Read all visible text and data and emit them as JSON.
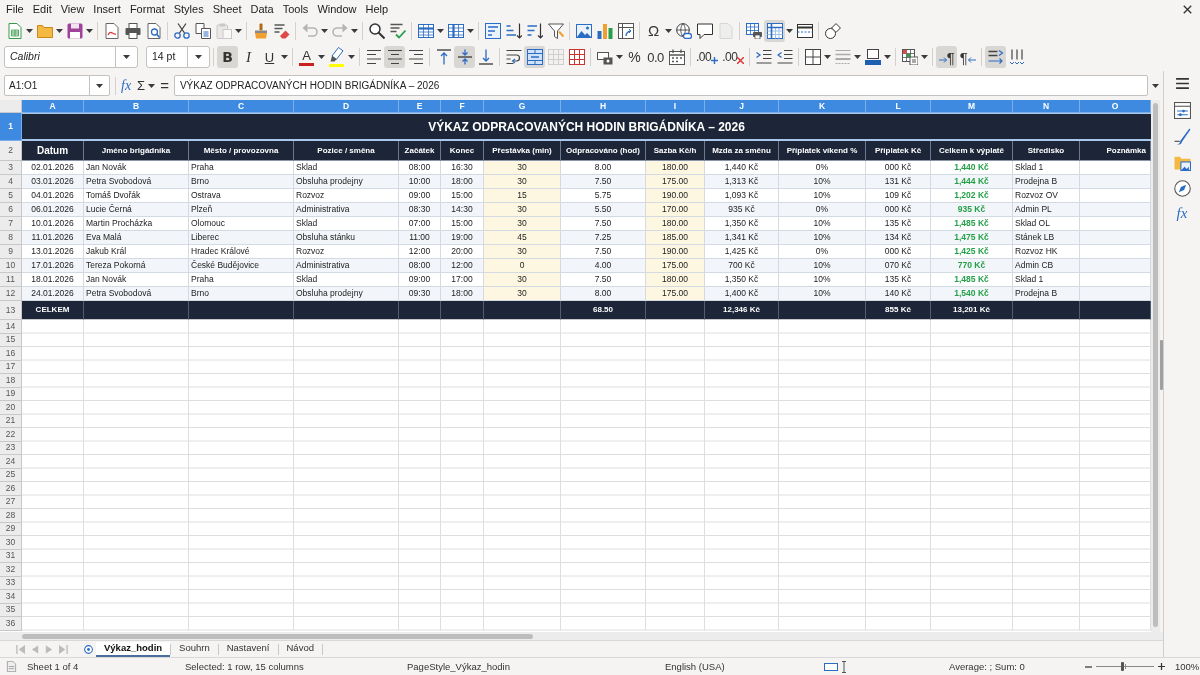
{
  "menu": [
    "File",
    "Edit",
    "View",
    "Insert",
    "Format",
    "Styles",
    "Sheet",
    "Data",
    "Tools",
    "Window",
    "Help"
  ],
  "standard_toolbar": {
    "paste": {
      "disabled": true
    },
    "undo": {
      "disabled": true
    },
    "redo": {
      "disabled": true
    },
    "special_character": {
      "label": "Ω"
    },
    "header_footer": {
      "disabled": true
    },
    "freeze": {
      "on": true
    }
  },
  "formatting_toolbar": {
    "font_name": "Calibri",
    "font_size": "14 pt",
    "bold": {
      "label": "B",
      "on": true
    },
    "italic": {
      "label": "I",
      "on": false
    },
    "underline": {
      "label": "U",
      "on": false
    },
    "font_color": {
      "label": "A"
    },
    "align_left": {
      "on": false
    },
    "align_center": {
      "on": true
    },
    "align_right": {
      "on": false
    },
    "align_top": {
      "on": false
    },
    "align_middle": {
      "on": true
    },
    "align_bottom": {
      "on": false
    },
    "wrap": {
      "on": false
    },
    "merge_center": {
      "on": true
    },
    "merge": {
      "disabled": true
    },
    "percent": {
      "label": "%"
    },
    "standard": {
      "label": "0.0"
    },
    "add_decimal": {
      "label": ".00"
    },
    "delete_decimal": {
      "label": ".00"
    },
    "left_to_right": {
      "label": "¶",
      "on": true
    },
    "right_to_left": {
      "label": "¶",
      "on": false
    },
    "text_horizontal": {
      "on": true
    },
    "text_vertical": {
      "on": false
    }
  },
  "formula_bar": {
    "name_box": "A1:O1",
    "function_wizard": "fx",
    "sum": "Σ",
    "equals": "=",
    "content": "VÝKAZ ODPRACOVANÝCH HODIN BRIGÁDNÍKA – 2026"
  },
  "sheet": {
    "column_headers": [
      {
        "label": "A",
        "selected": true
      },
      {
        "label": "B",
        "selected": true
      },
      {
        "label": "C",
        "selected": true
      },
      {
        "label": "D",
        "selected": true
      },
      {
        "label": "E",
        "selected": true
      },
      {
        "label": "F",
        "selected": true
      },
      {
        "label": "G",
        "selected": true
      },
      {
        "label": "H",
        "selected": true
      },
      {
        "label": "I",
        "selected": true
      },
      {
        "label": "J",
        "selected": true
      },
      {
        "label": "K",
        "selected": true
      },
      {
        "label": "L",
        "selected": true
      },
      {
        "label": "M",
        "selected": true
      },
      {
        "label": "N",
        "selected": true
      },
      {
        "label": "O",
        "selected": true
      }
    ],
    "row_headers": [
      {
        "label": "1",
        "selected": true
      },
      {
        "label": "2",
        "selected": false
      },
      {
        "label": "3",
        "selected": false
      },
      {
        "label": "4",
        "selected": false
      },
      {
        "label": "5",
        "selected": false
      },
      {
        "label": "6",
        "selected": false
      },
      {
        "label": "7",
        "selected": false
      },
      {
        "label": "8",
        "selected": false
      },
      {
        "label": "9",
        "selected": false
      },
      {
        "label": "10",
        "selected": false
      },
      {
        "label": "11",
        "selected": false
      },
      {
        "label": "12",
        "selected": false
      },
      {
        "label": "13",
        "selected": false
      },
      {
        "label": "14",
        "selected": false
      },
      {
        "label": "15",
        "selected": false
      },
      {
        "label": "16",
        "selected": false
      },
      {
        "label": "17",
        "selected": false
      },
      {
        "label": "18",
        "selected": false
      },
      {
        "label": "19",
        "selected": false
      },
      {
        "label": "20",
        "selected": false
      },
      {
        "label": "21",
        "selected": false
      },
      {
        "label": "22",
        "selected": false
      },
      {
        "label": "23",
        "selected": false
      },
      {
        "label": "24",
        "selected": false
      },
      {
        "label": "25",
        "selected": false
      },
      {
        "label": "26",
        "selected": false
      },
      {
        "label": "27",
        "selected": false
      },
      {
        "label": "28",
        "selected": false
      },
      {
        "label": "29",
        "selected": false
      },
      {
        "label": "30",
        "selected": false
      },
      {
        "label": "31",
        "selected": false
      },
      {
        "label": "32",
        "selected": false
      },
      {
        "label": "33",
        "selected": false
      },
      {
        "label": "34",
        "selected": false
      },
      {
        "label": "35",
        "selected": false
      },
      {
        "label": "36",
        "selected": false
      }
    ],
    "title": "VÝKAZ ODPRACOVANÝCH HODIN BRIGÁDNÍKA – 2026",
    "headings": [
      "Datum",
      "Jméno brigádníka",
      "Město / provozovna",
      "Pozice / směna",
      "Začátek",
      "Konec",
      "Přestávka (min)",
      "Odpracováno (hod)",
      "Sazba Kč/h",
      "Mzda za směnu",
      "Příplatek víkend %",
      "Příplatek Kč",
      "Celkem k výplatě",
      "Středisko",
      "Poznámka"
    ],
    "rows": [
      [
        "02.01.2026",
        "Jan Novák",
        "Praha",
        "Sklad",
        "08:00",
        "16:30",
        "30",
        "8.00",
        "180.00",
        "1,440 Kč",
        "0%",
        "000 Kč",
        "1,440 Kč",
        "Sklad 1"
      ],
      [
        "03.01.2026",
        "Petra Svobodová",
        "Brno",
        "Obsluha prodejny",
        "10:00",
        "18:00",
        "30",
        "7.50",
        "175.00",
        "1,313 Kč",
        "10%",
        "131 Kč",
        "1,444 Kč",
        "Prodejna B"
      ],
      [
        "04.01.2026",
        "Tomáš Dvořák",
        "Ostrava",
        "Rozvoz",
        "09:00",
        "15:00",
        "15",
        "5.75",
        "190.00",
        "1,093 Kč",
        "10%",
        "109 Kč",
        "1,202 Kč",
        "Rozvoz OV"
      ],
      [
        "06.01.2026",
        "Lucie Černá",
        "Plzeň",
        "Administrativa",
        "08:30",
        "14:30",
        "30",
        "5.50",
        "170.00",
        "935 Kč",
        "0%",
        "000 Kč",
        "935 Kč",
        "Admin PL"
      ],
      [
        "10.01.2026",
        "Martin Procházka",
        "Olomouc",
        "Sklad",
        "07:00",
        "15:00",
        "30",
        "7.50",
        "180.00",
        "1,350 Kč",
        "10%",
        "135 Kč",
        "1,485 Kč",
        "Sklad OL"
      ],
      [
        "11.01.2026",
        "Eva Malá",
        "Liberec",
        "Obsluha stánku",
        "11:00",
        "19:00",
        "45",
        "7.25",
        "185.00",
        "1,341 Kč",
        "10%",
        "134 Kč",
        "1,475 Kč",
        "Stánek LB"
      ],
      [
        "13.01.2026",
        "Jakub Král",
        "Hradec Králové",
        "Rozvoz",
        "12:00",
        "20:00",
        "30",
        "7.50",
        "190.00",
        "1,425 Kč",
        "0%",
        "000 Kč",
        "1,425 Kč",
        "Rozvoz HK"
      ],
      [
        "17.01.2026",
        "Tereza Pokorná",
        "České Budějovice",
        "Administrativa",
        "08:00",
        "12:00",
        "0",
        "4.00",
        "175.00",
        "700 Kč",
        "10%",
        "070 Kč",
        "770 Kč",
        "Admin CB"
      ],
      [
        "18.01.2026",
        "Jan Novák",
        "Praha",
        "Sklad",
        "09:00",
        "17:00",
        "30",
        "7.50",
        "180.00",
        "1,350 Kč",
        "10%",
        "135 Kč",
        "1,485 Kč",
        "Sklad 1"
      ],
      [
        "24.01.2026",
        "Petra Svobodová",
        "Brno",
        "Obsluha prodejny",
        "09:30",
        "18:00",
        "30",
        "8.00",
        "175.00",
        "1,400 Kč",
        "10%",
        "140 Kč",
        "1,540 Kč",
        "Prodejna B"
      ]
    ],
    "totals": {
      "label": "CELKEM",
      "hours": "68.50",
      "wage": "12,346 Kč",
      "surcharge": "855 Kč",
      "payout": "13,201 Kč"
    }
  },
  "sidebar": {
    "functions": "fx"
  },
  "sheet_tabs": [
    {
      "label": "Výkaz_hodin",
      "selected": true
    },
    {
      "label": "Souhrn",
      "selected": false
    },
    {
      "label": "Nastavení",
      "selected": false
    },
    {
      "label": "Návod",
      "selected": false
    }
  ],
  "status_bar": {
    "sheet": "Sheet 1 of 4",
    "selection": "Selected: 1 row, 15 columns",
    "page_style": "PageStyle_Výkaz_hodin",
    "language": "English (USA)",
    "summary": "Average: ; Sum: 0",
    "zoom": {
      "level": 0.45,
      "reading": "100%"
    }
  }
}
